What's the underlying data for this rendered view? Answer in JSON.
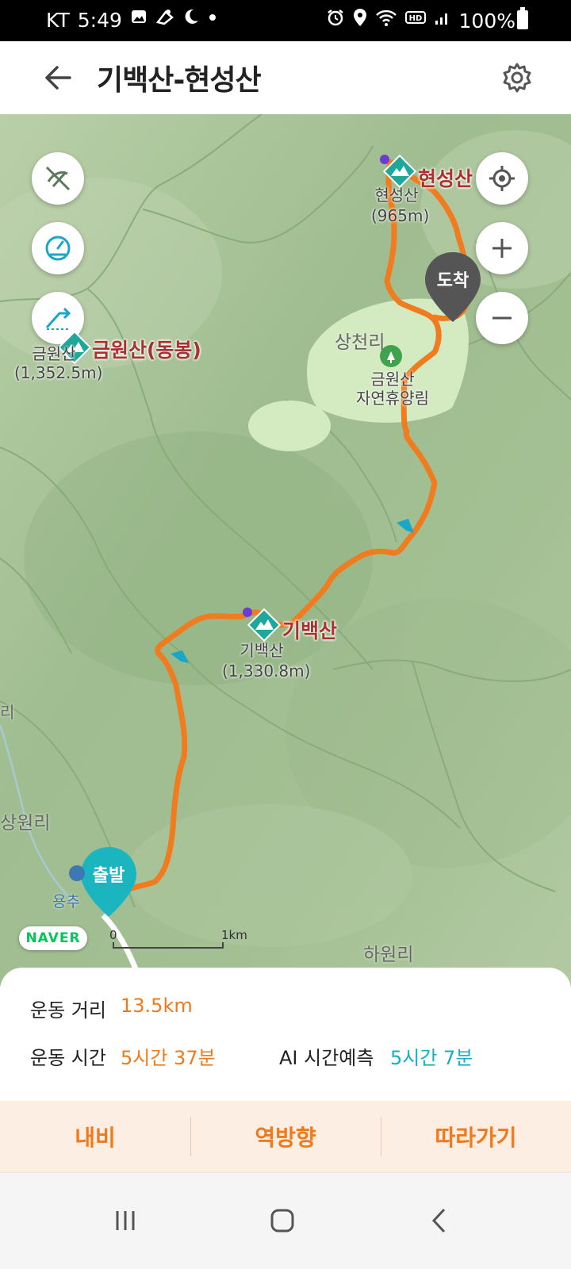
{
  "status_bar": {
    "carrier": "KT",
    "time": "5:49",
    "battery": "100%",
    "left_icons": [
      "gallery-icon",
      "puzzle-icon",
      "moon-icon",
      "dot-icon"
    ],
    "right_icons": [
      "alarm-icon",
      "location-icon",
      "wifi-icon",
      "hd-icon",
      "signal-icon",
      "battery-icon"
    ]
  },
  "header": {
    "title": "기백산-현성산",
    "back_icon": "arrow-left-icon",
    "settings_icon": "gear-icon"
  },
  "map": {
    "controls_left": [
      "route-hide-icon",
      "speedometer-icon",
      "elevation-icon"
    ],
    "controls_right": [
      "my-location-icon",
      "zoom-in-icon",
      "zoom-out-icon"
    ],
    "peaks": [
      {
        "name": "현성산",
        "sub_name": "현성산",
        "elevation": "(965m)"
      },
      {
        "name": "금원산(동봉)",
        "sub_name": "금원산",
        "elevation": "(1,352.5m)"
      },
      {
        "name": "기백산",
        "sub_name": "기백산",
        "elevation": "(1,330.8m)"
      }
    ],
    "villages": [
      "상천리",
      "상원리",
      "하원리",
      "용추"
    ],
    "forest_label_1": "금원산",
    "forest_label_2": "자연휴양림",
    "edge_label": "리",
    "pin_end": "도착",
    "pin_start": "출발",
    "brand": "NAVER",
    "scale_zero": "0",
    "scale_km": "1km",
    "route_color": "#f07c1f",
    "forest_color": "#d7ecc4"
  },
  "summary": {
    "distance_label": "운동 거리",
    "distance_value": "13.5km",
    "time_label": "운동 시간",
    "time_value": "5시간 37분",
    "ai_label": "AI 시간예측",
    "ai_value": "5시간 7분",
    "value_color": "#ef7a1c",
    "ai_color": "#12b0c1"
  },
  "actions": [
    "내비",
    "역방향",
    "따라가기"
  ],
  "nav_bar": [
    "recent-apps-icon",
    "home-icon",
    "back-icon"
  ]
}
